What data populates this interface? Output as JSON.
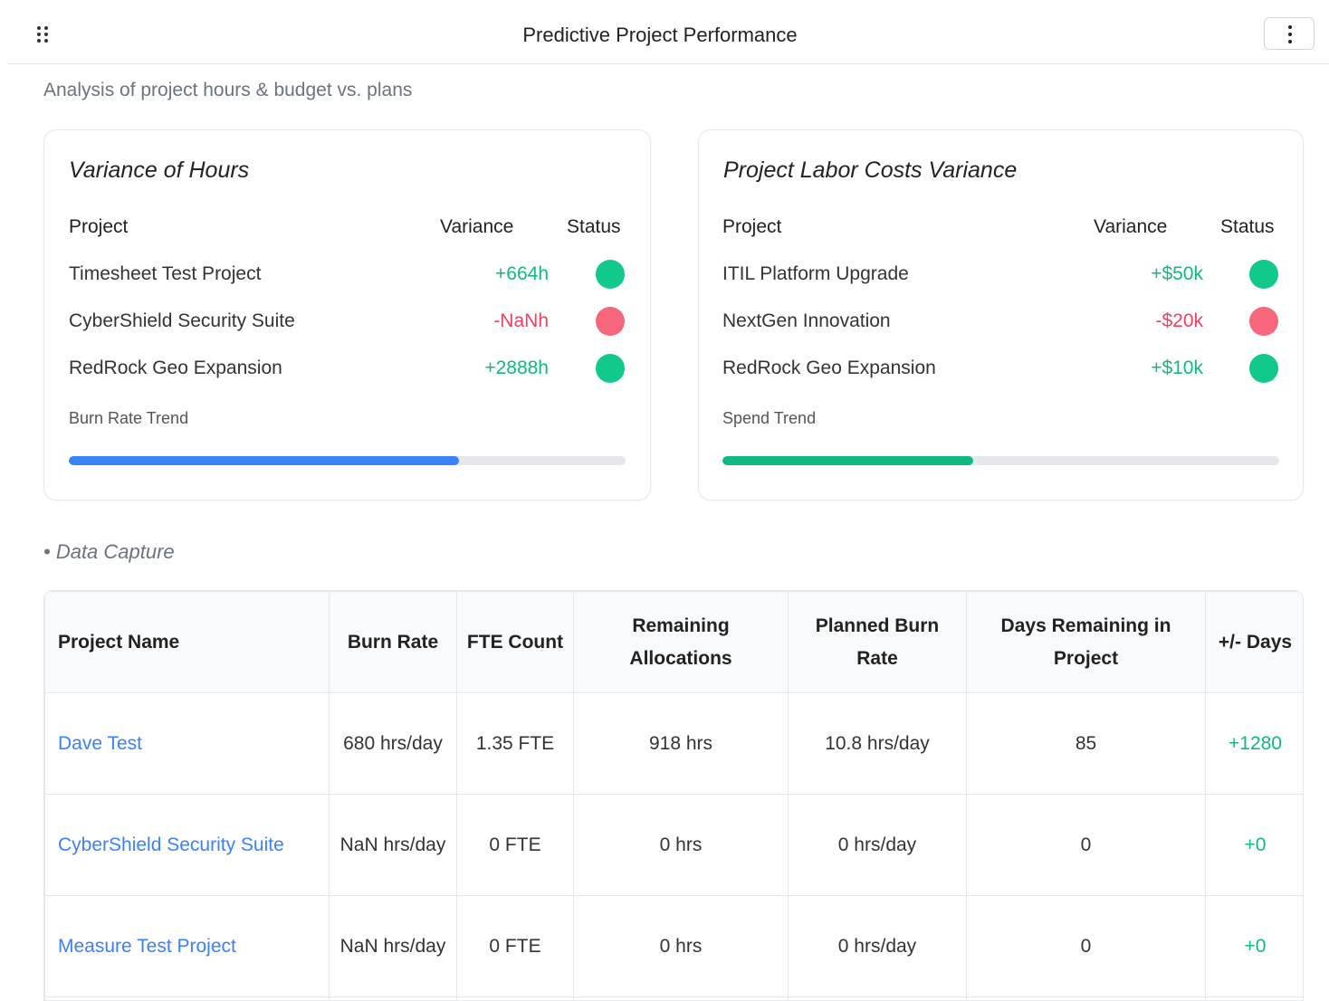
{
  "header": {
    "title": "Predictive Project Performance",
    "drag_icon": "drag-handle-icon",
    "menu_icon": "more-vertical-icon"
  },
  "subtitle": "Analysis of project hours & budget vs. plans",
  "colors": {
    "positive": "#10b981",
    "negative": "#f43f5e",
    "link": "#3b82f6",
    "burn_bar": "#3b82f6",
    "spend_bar": "#10b981"
  },
  "hours_card": {
    "title": "Variance of Hours",
    "columns": [
      "Project",
      "Variance",
      "Status"
    ],
    "rows": [
      {
        "project": "Timesheet Test Project",
        "variance": "+664h",
        "status": "good"
      },
      {
        "project": "CyberShield Security Suite",
        "variance": "-NaNh",
        "status": "bad"
      },
      {
        "project": "RedRock Geo Expansion",
        "variance": "+2888h",
        "status": "good"
      }
    ],
    "trend_label": "Burn Rate Trend",
    "trend_progress": 0.7
  },
  "costs_card": {
    "title": "Project Labor Costs Variance",
    "columns": [
      "Project",
      "Variance",
      "Status"
    ],
    "rows": [
      {
        "project": "ITIL Platform Upgrade",
        "variance": "+$50k",
        "status": "good"
      },
      {
        "project": "NextGen Innovation",
        "variance": "-$20k",
        "status": "bad"
      },
      {
        "project": "RedRock Geo Expansion",
        "variance": "+$10k",
        "status": "good"
      }
    ],
    "trend_label": "Spend Trend",
    "trend_progress": 0.45
  },
  "data_capture": {
    "label": "• Data Capture",
    "columns": [
      "Project Name",
      "Burn Rate",
      "FTE Count",
      "Remaining Allocations",
      "Planned Burn Rate",
      "Days Remaining in Project",
      "+/- Days"
    ],
    "rows": [
      {
        "name": "Dave Test",
        "burn_rate": "680 hrs/day",
        "fte": "1.35 FTE",
        "remaining": "918 hrs",
        "planned": "10.8 hrs/day",
        "days_remaining": "85",
        "plus_minus": "+1280"
      },
      {
        "name": "CyberShield Security Suite",
        "burn_rate": "NaN hrs/day",
        "fte": "0 FTE",
        "remaining": "0 hrs",
        "planned": "0 hrs/day",
        "days_remaining": "0",
        "plus_minus": "+0"
      },
      {
        "name": "Measure Test Project",
        "burn_rate": "NaN hrs/day",
        "fte": "0 FTE",
        "remaining": "0 hrs",
        "planned": "0 hrs/day",
        "days_remaining": "0",
        "plus_minus": "+0"
      }
    ]
  }
}
